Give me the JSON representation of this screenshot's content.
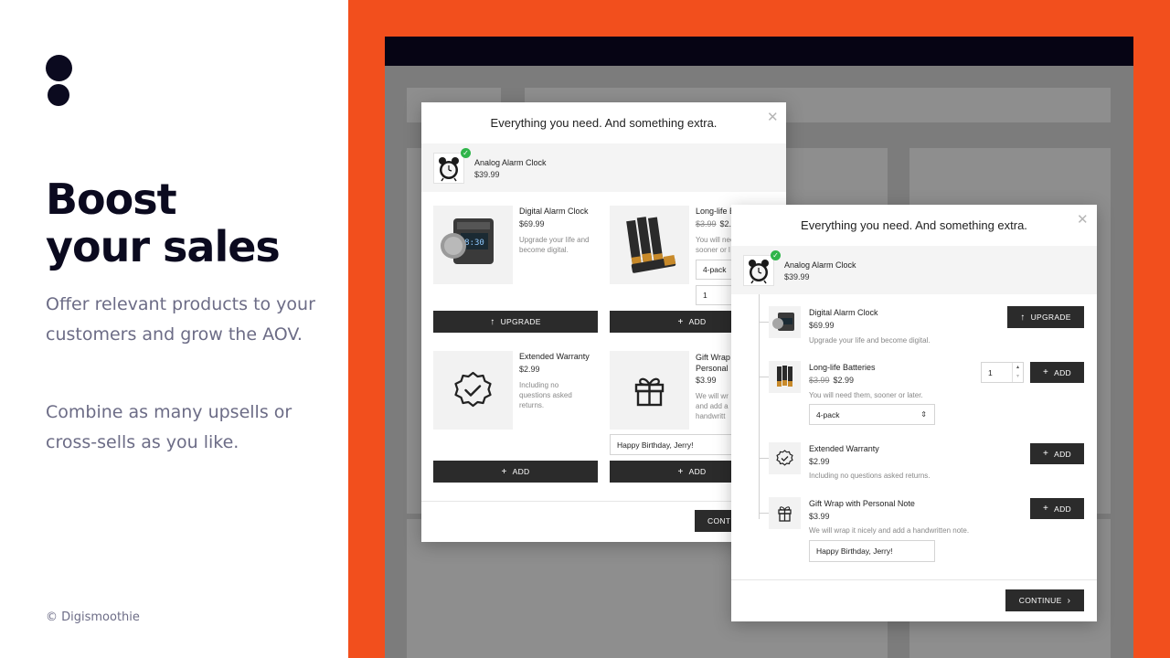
{
  "hero": {
    "headline_line1": "Boost",
    "headline_line2": "your sales",
    "copy1": "Offer relevant products to your customers and grow the AOV.",
    "copy2": "Combine as many upsells or cross-sells as you like.",
    "credit": "© Digismoothie"
  },
  "colors": {
    "accent": "#f24f1d",
    "navy": "#0b0a1f",
    "button": "#2b2b2b",
    "check": "#2fb54a"
  },
  "modal_title": "Everything you need. And something extra.",
  "main_product": {
    "name": "Analog Alarm Clock",
    "price": "$39.99",
    "icon": "alarm-clock-icon"
  },
  "grid_modal": {
    "cards": [
      {
        "name": "Digital Alarm Clock",
        "price": "$69.99",
        "desc": "Upgrade your life and become digital.",
        "button": "UPGRADE",
        "icon": "digital-clock-icon"
      },
      {
        "name": "Long-life B",
        "old_price": "$3.99",
        "price": "$2.",
        "desc": "You will nee sooner or l",
        "select": "4-pack",
        "qty": "1",
        "button": "ADD",
        "icon": "batteries-icon"
      },
      {
        "name": "Extended Warranty",
        "price": "$2.99",
        "desc": "Including no questions asked returns.",
        "button": "ADD",
        "icon": "badge-check-icon"
      },
      {
        "name": "Gift Wrap Personal",
        "price": "$3.99",
        "desc": "We will wr and add a handwritt",
        "note": "Happy Birthday, Jerry!",
        "button": "ADD",
        "icon": "gift-icon"
      }
    ],
    "continue": "CONT"
  },
  "list_modal": {
    "items": [
      {
        "name": "Digital Alarm Clock",
        "price": "$69.99",
        "desc": "Upgrade your life and become digital.",
        "button": "UPGRADE"
      },
      {
        "name": "Long-life Batteries",
        "old_price": "$3.99",
        "price": "$2.99",
        "desc": "You will need them, sooner or later.",
        "select": "4-pack",
        "qty": "1",
        "button": "ADD"
      },
      {
        "name": "Extended Warranty",
        "price": "$2.99",
        "desc": "Including no questions asked returns.",
        "button": "ADD"
      },
      {
        "name": "Gift Wrap with Personal Note",
        "price": "$3.99",
        "desc": "We will wrap it nicely and add a handwritten note.",
        "note": "Happy Birthday, Jerry!",
        "button": "ADD"
      }
    ],
    "continue": "CONTINUE"
  }
}
